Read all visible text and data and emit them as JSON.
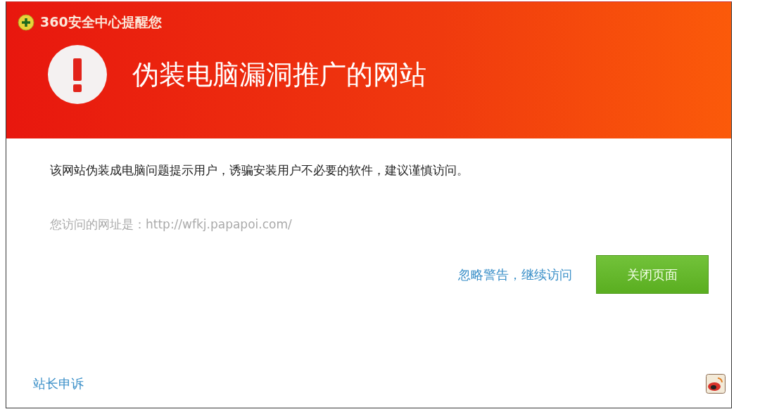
{
  "window": {
    "title": "360安全中心提醒您"
  },
  "alert": {
    "headline": "伪装电脑漏洞推广的网站"
  },
  "message": "该网站伪装成电脑问题提示用户，诱骗安装用户不必要的软件，建议谨慎访问。",
  "url_line": "您访问的网址是：http://wfkj.papapoi.com/",
  "actions": {
    "ignore_link": "忽略警告，继续访问",
    "close_button": "关闭页面"
  },
  "footer": {
    "appeal_link": "站长申诉"
  }
}
